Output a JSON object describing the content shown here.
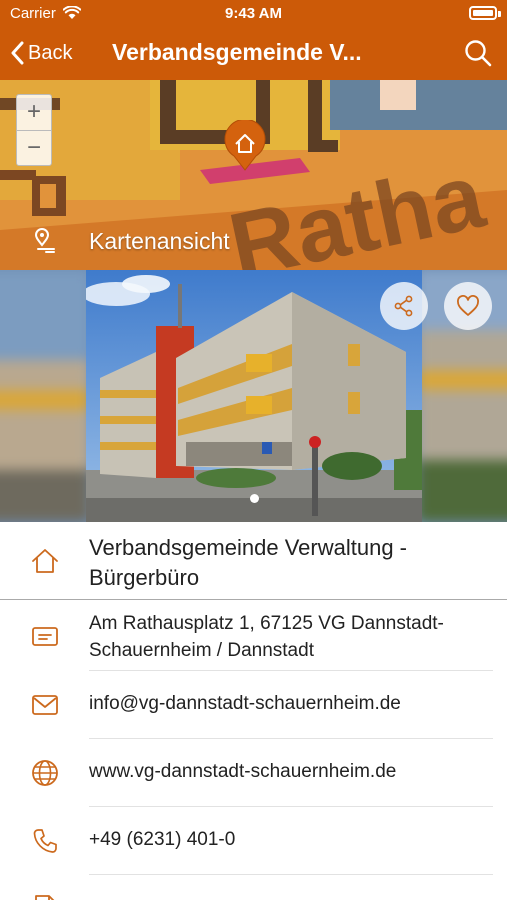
{
  "status_bar": {
    "carrier": "Carrier",
    "time": "9:43 AM"
  },
  "nav": {
    "back_label": "Back",
    "title": "Verbandsgemeinde V..."
  },
  "map": {
    "zoom_in": "+",
    "zoom_out": "−",
    "view_label": "Kartenansicht"
  },
  "gallery": {
    "active_index": 0,
    "count": 1
  },
  "info": {
    "name": "Verbandsgemeinde Verwaltung - Bürgerbüro",
    "address": "Am Rathausplatz 1, 67125 VG Dannstadt-Schauernheim / Dannstadt",
    "email": "info@vg-dannstadt-schauernheim.de",
    "website": "www.vg-dannstadt-schauernheim.de",
    "phone": "+49 (6231) 401-0"
  },
  "colors": {
    "accent": "#cc5a08",
    "icon": "#cc6a1e"
  },
  "icons": [
    "wifi-icon",
    "battery-icon",
    "chevron-left-icon",
    "search-icon",
    "home-pin-icon",
    "location-pin-icon",
    "share-icon",
    "heart-icon",
    "home-icon",
    "address-card-icon",
    "mail-icon",
    "globe-icon",
    "phone-icon",
    "document-icon"
  ]
}
